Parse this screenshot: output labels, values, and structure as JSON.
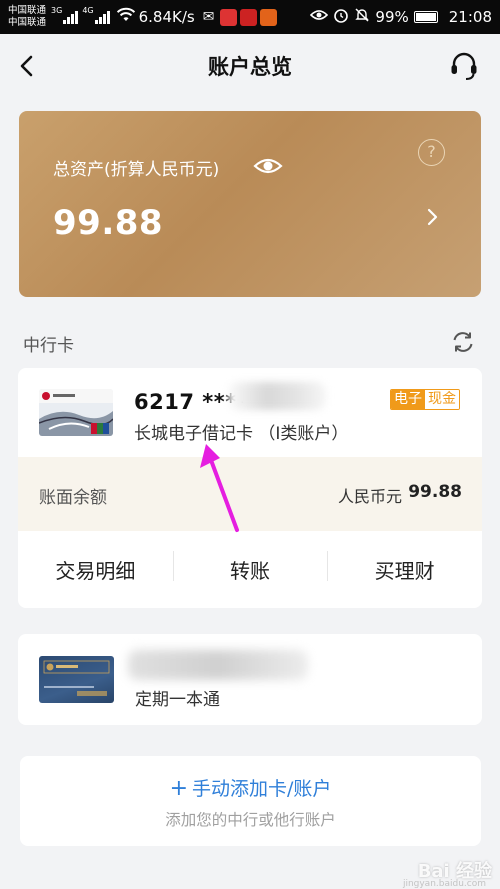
{
  "status_bar": {
    "carrier_1": "中国联通",
    "carrier_2": "中国联通",
    "net_1": "3G",
    "net_2": "4G",
    "speed": "6.84K/s",
    "battery": "99%",
    "time": "21:08"
  },
  "header": {
    "title": "账户总览",
    "icons": {
      "back": "back-arrow-icon",
      "support": "headset-icon"
    }
  },
  "asset_card": {
    "label": "总资产(折算人民币元)",
    "value": "99.88",
    "help_symbol": "?",
    "colors": {
      "gold": "#c29a67"
    }
  },
  "section": {
    "title": "中行卡"
  },
  "debit_card": {
    "number": "6217 ****",
    "name": "长城电子借记卡 （I类账户）",
    "tag_primary": "电子",
    "tag_secondary": "现金",
    "balance_label": "账面余额",
    "currency": "人民币元",
    "balance": "99.88",
    "actions": [
      "交易明细",
      "转账",
      "买理财"
    ]
  },
  "deposit_card": {
    "name": "定期一本通"
  },
  "add_account": {
    "plus": "+",
    "title": "手动添加卡/账户",
    "subtitle": "添加您的中行或他行账户"
  },
  "watermark": {
    "text": "Bai 经验",
    "sub": "jingyan.baidu.com"
  },
  "colors": {
    "accent_blue": "#2f7fd9",
    "tag_orange": "#f09a1a",
    "pointer_magenta": "#e51ee0"
  }
}
